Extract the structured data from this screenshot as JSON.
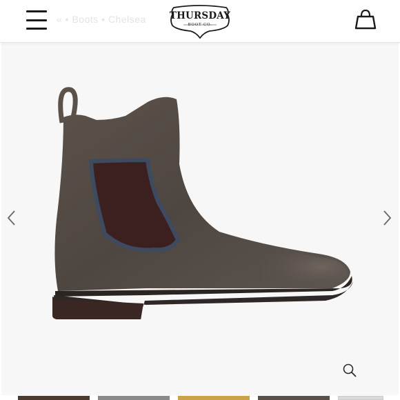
{
  "header": {
    "menu_icon": "hamburger-menu-icon",
    "breadcrumb_ghost": "« • Boots • Chelsea",
    "logo": {
      "name": "THURSDAY",
      "tagline": "BOOT CO."
    },
    "cart_icon": "shopping-bag-icon"
  },
  "gallery": {
    "product_image": "suede-chelsea-boot",
    "prev_icon": "chevron-left-icon",
    "next_icon": "chevron-right-icon",
    "zoom_icon": "magnifier-icon"
  },
  "thumbnails": [
    {
      "color": "#4a3a30"
    },
    {
      "color": "#8a8a8a"
    },
    {
      "color": "#c9a24a"
    },
    {
      "color": "#5a5048"
    },
    {
      "color": "#d9d9d9"
    }
  ]
}
